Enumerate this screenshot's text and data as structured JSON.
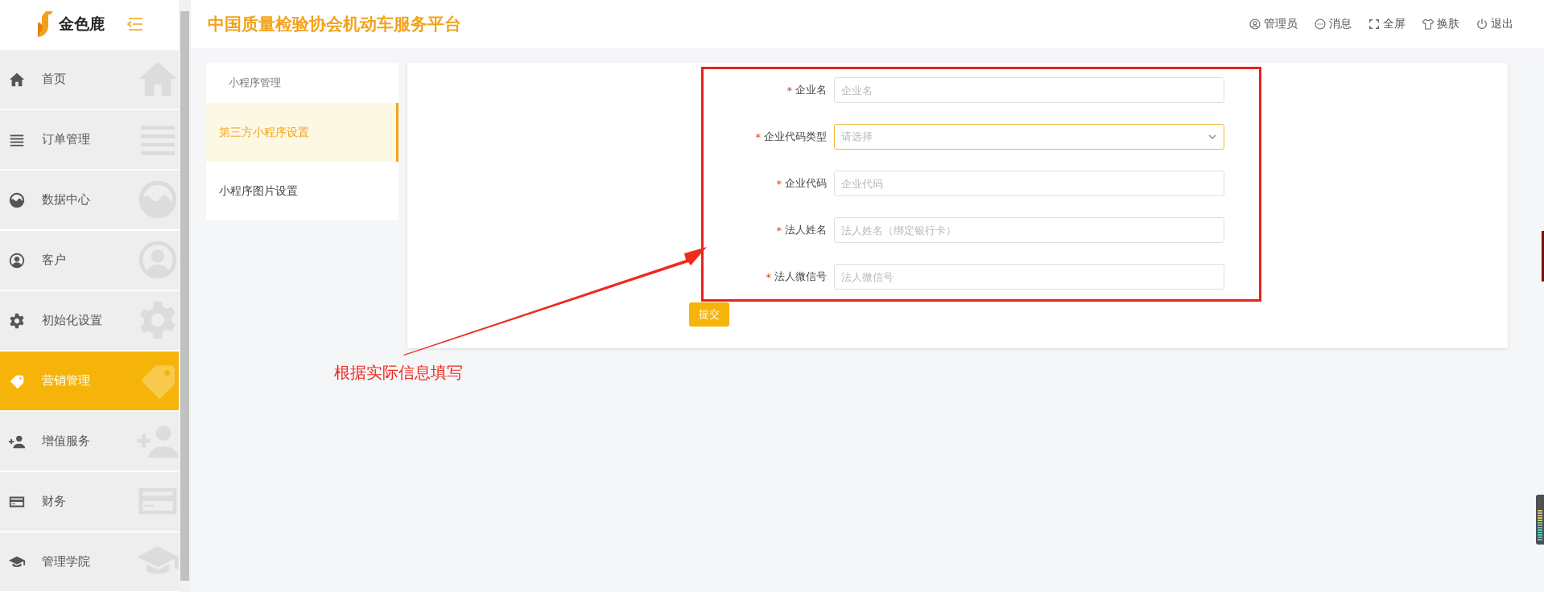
{
  "logo": {
    "text": "金色鹿"
  },
  "sidebar": {
    "items": [
      {
        "label": "首页",
        "selected": false
      },
      {
        "label": "订单管理",
        "selected": false
      },
      {
        "label": "数据中心",
        "selected": false
      },
      {
        "label": "客户",
        "selected": false
      },
      {
        "label": "初始化设置",
        "selected": false
      },
      {
        "label": "营销管理",
        "selected": true
      },
      {
        "label": "增值服务",
        "selected": false
      },
      {
        "label": "财务",
        "selected": false
      },
      {
        "label": "管理学院",
        "selected": false
      }
    ]
  },
  "header": {
    "title": "中国质量检验协会机动车服务平台",
    "actions": [
      {
        "label": "管理员"
      },
      {
        "label": "消息"
      },
      {
        "label": "全屏"
      },
      {
        "label": "换肤"
      },
      {
        "label": "退出"
      }
    ]
  },
  "submenu": {
    "heading": "小程序管理",
    "items": [
      {
        "label": "第三方小程序设置",
        "selected": true
      },
      {
        "label": "小程序图片设置",
        "selected": false
      }
    ]
  },
  "form": {
    "fields": [
      {
        "required_mark": "*",
        "label": "企业名",
        "kind": "input",
        "placeholder": "企业名"
      },
      {
        "required_mark": "*",
        "label": "企业代码类型",
        "kind": "select",
        "placeholder": "请选择"
      },
      {
        "required_mark": "*",
        "label": "企业代码",
        "kind": "input",
        "placeholder": "企业代码"
      },
      {
        "required_mark": "*",
        "label": "法人姓名",
        "kind": "input",
        "placeholder": "法人姓名（绑定银行卡）"
      },
      {
        "required_mark": "*",
        "label": "法人微信号",
        "kind": "input",
        "placeholder": "法人微信号"
      }
    ],
    "submit": "提交"
  },
  "annotation": {
    "text": "根据实际信息填写"
  }
}
